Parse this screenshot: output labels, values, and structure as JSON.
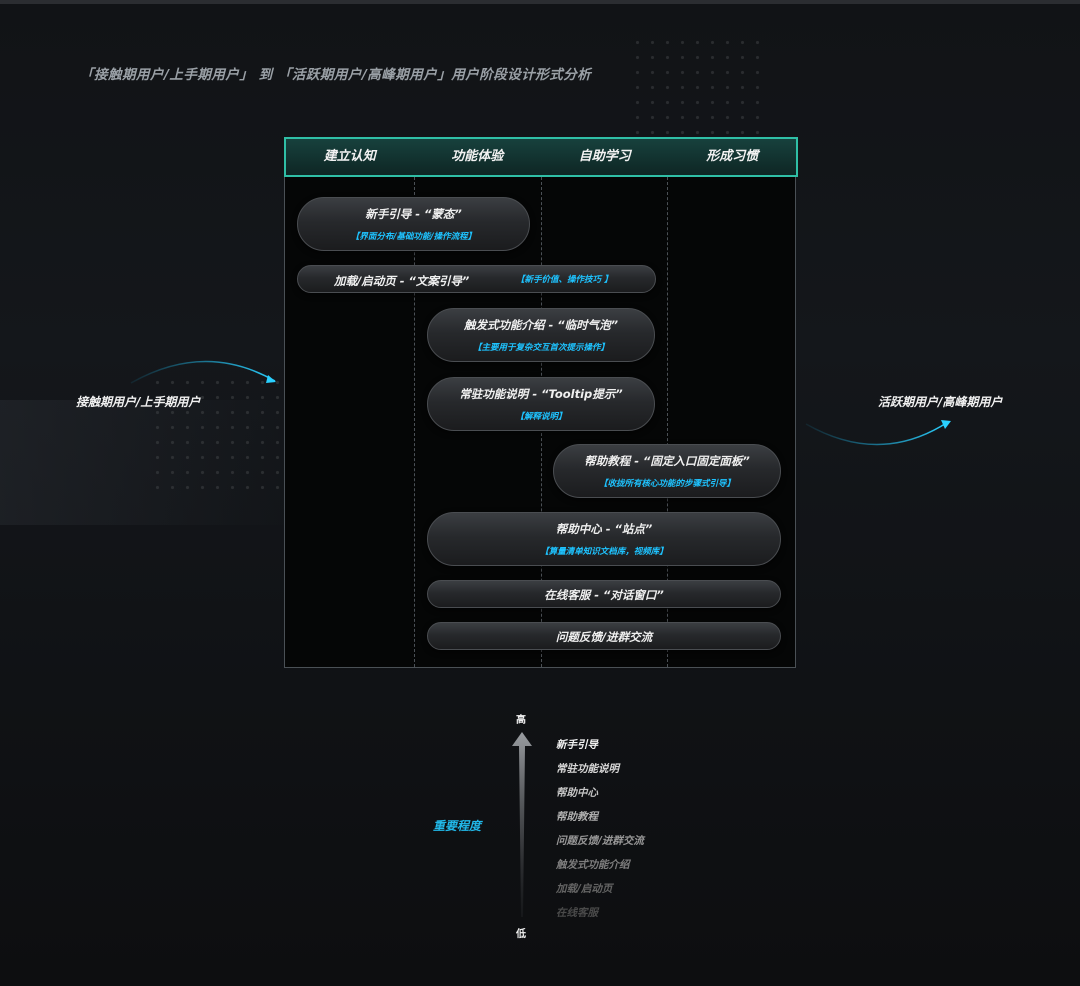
{
  "title": "「接触期用户/上手期用户」 到 「活跃期用户/高峰期用户」用户阶段设计形式分析",
  "stages": [
    "建立认知",
    "功能体验",
    "自助学习",
    "形成习惯"
  ],
  "left_user": "接触期用户/上手期用户",
  "right_user": "活跃期用户/高峰期用户",
  "pills": [
    {
      "title": "新手引导 - “蒙态”",
      "sub": "【界面分布/基础功能/操作流程】",
      "stages_span": [
        1,
        2
      ]
    },
    {
      "title": "加载/启动页 - “文案引导”",
      "sub": "【新手价值、操作技巧 】",
      "stages_span": [
        1,
        3
      ]
    },
    {
      "title": "触发式功能介绍 - “临时气泡”",
      "sub": "【主要用于复杂交互首次提示操作】",
      "stages_span": [
        2,
        3
      ]
    },
    {
      "title": "常驻功能说明 - “Tooltip提示”",
      "sub": "【解释说明】",
      "stages_span": [
        2,
        3
      ]
    },
    {
      "title": "帮助教程 - “固定入口固定面板”",
      "sub": "【收拢所有核心功能的步骤式引导】",
      "stages_span": [
        3,
        4
      ]
    },
    {
      "title": "帮助中心 - “站点”",
      "sub": "【算量清单知识文档库，视频库】",
      "stages_span": [
        2,
        4
      ]
    },
    {
      "title": "在线客服 - “对话窗口”",
      "sub": "",
      "stages_span": [
        2,
        4
      ]
    },
    {
      "title": "问题反馈/进群交流",
      "sub": "",
      "stages_span": [
        2,
        4
      ]
    }
  ],
  "importance": {
    "label": "重要程度",
    "high": "高",
    "low": "低",
    "ranking": [
      "新手引导",
      "常驻功能说明",
      "帮助中心",
      "帮助教程",
      "问题反馈/进群交流",
      "触发式功能介绍",
      "加载/启动页",
      "在线客服"
    ]
  },
  "colors": {
    "accent": "#2fbfa6",
    "highlight": "#1ec3ff",
    "background": "#121417"
  }
}
